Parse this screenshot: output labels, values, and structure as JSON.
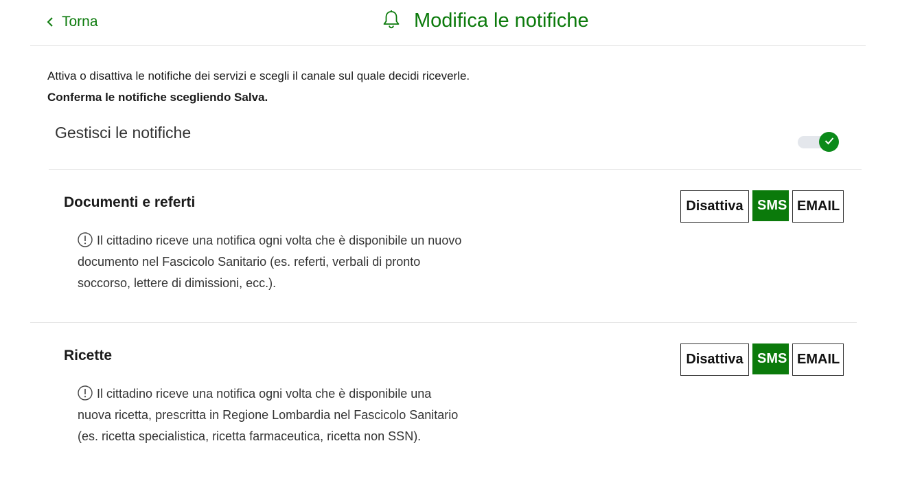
{
  "header": {
    "back_label": "Torna",
    "title": "Modifica le notifiche",
    "title_icon": "bell-icon"
  },
  "intro": {
    "description": "Attiva o disattiva le notifiche dei servizi e scegli il canale sul quale decidi riceverle.",
    "confirm": "Conferma le notifiche scegliendo Salva."
  },
  "manage": {
    "label": "Gestisci le notifiche",
    "toggle_on": true
  },
  "sections": [
    {
      "title": "Documenti e referti",
      "info": "Il cittadino riceve una notifica ogni volta che è disponibile un nuovo documento nel Fascicolo Sanitario (es. referti, verbali di pronto soccorso, lettere di dimissioni, ecc.).",
      "channels": [
        "Disattiva",
        "SMS",
        "EMAIL"
      ],
      "selected": "SMS"
    },
    {
      "title": "Ricette",
      "info": "Il cittadino riceve una notifica ogni volta che è disponibile una nuova ricetta, prescritta in Regione Lombardia nel Fascicolo Sanitario (es. ricetta specialistica, ricetta farmaceutica, ricetta non SSN).",
      "channels": [
        "Disattiva",
        "SMS",
        "EMAIL"
      ],
      "selected": "SMS"
    }
  ],
  "colors": {
    "accent": "#0b7a0b",
    "toggle_on": "#0b8a1a",
    "divider": "#e6e6e6"
  }
}
